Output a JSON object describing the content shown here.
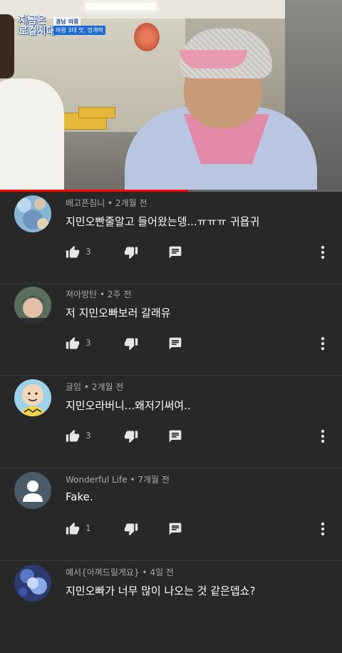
{
  "video": {
    "logo_line1": "지금은",
    "logo_line2": "로컬시대",
    "tag_region": "경남 의령",
    "tag_subtitle": "의령 3대 맛, 망개떡",
    "progress": 0.55,
    "progress_color": "#ff0000"
  },
  "comments": [
    {
      "author": "배고픈침니",
      "time": "2개월 전",
      "text": "지민오빤줄알고 들어왔는뎅...ㅠㅠㅠ 귀욥귀",
      "likes": "3"
    },
    {
      "author": "져아방탄",
      "time": "2주 전",
      "text": "저 지민오빠보러 갈래유",
      "likes": "3"
    },
    {
      "author": "글임",
      "time": "2개월 전",
      "text": "지민오라버니...왜저기써여..",
      "likes": "3"
    },
    {
      "author": "Wonderful Life",
      "time": "7개월 전",
      "text": "Fake.",
      "likes": "1"
    },
    {
      "author": "예서{아껴드릴게요}",
      "time": "4일 전",
      "text": "지민오빠가 너무 많이 나오는 것 같은뎁쇼?",
      "likes": ""
    }
  ],
  "icons": {
    "like": "thumbs-up-icon",
    "dislike": "thumbs-down-icon",
    "reply": "comment-reply-icon",
    "more": "more-vert-icon"
  },
  "colors": {
    "background": "#282828",
    "meta_text": "#aaaaaa",
    "comment_text": "#ffffff",
    "icon": "#e6e6e6"
  }
}
